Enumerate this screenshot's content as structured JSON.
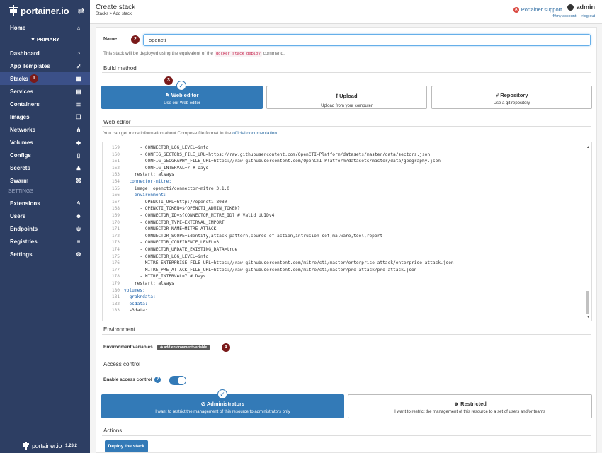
{
  "brand": {
    "name": "portainer.io",
    "toggle_icon": "exchange-icon"
  },
  "sidebar": {
    "items_top": [
      {
        "label": "Home",
        "icon": "home-icon",
        "glyph": "⌂"
      }
    ],
    "endpoint_label": "PRIMARY",
    "items_endpoint": [
      {
        "label": "Dashboard",
        "icon": "dashboard-icon",
        "glyph": "◔"
      },
      {
        "label": "App Templates",
        "icon": "rocket-icon",
        "glyph": "➶"
      },
      {
        "label": "Stacks",
        "icon": "th-list-icon",
        "glyph": "▦",
        "active": true
      },
      {
        "label": "Services",
        "icon": "list-alt-icon",
        "glyph": "▤"
      },
      {
        "label": "Containers",
        "icon": "server-icon",
        "glyph": "≣"
      },
      {
        "label": "Images",
        "icon": "clone-icon",
        "glyph": "❐"
      },
      {
        "label": "Networks",
        "icon": "sitemap-icon",
        "glyph": "⋔"
      },
      {
        "label": "Volumes",
        "icon": "cubes-icon",
        "glyph": "◆"
      },
      {
        "label": "Configs",
        "icon": "file-code-icon",
        "glyph": "▯"
      },
      {
        "label": "Secrets",
        "icon": "user-secret-icon",
        "glyph": "♟"
      },
      {
        "label": "Swarm",
        "icon": "object-group-icon",
        "glyph": "⌘"
      }
    ],
    "settings_title": "SETTINGS",
    "items_settings": [
      {
        "label": "Extensions",
        "icon": "bolt-icon",
        "glyph": "ϟ"
      },
      {
        "label": "Users",
        "icon": "users-icon",
        "glyph": "☻"
      },
      {
        "label": "Endpoints",
        "icon": "plug-icon",
        "glyph": "ψ"
      },
      {
        "label": "Registries",
        "icon": "database-icon",
        "glyph": "≡"
      },
      {
        "label": "Settings",
        "icon": "cogs-icon",
        "glyph": "⚙"
      }
    ],
    "footer_brand": "portainer.io",
    "version": "1.23.2"
  },
  "header": {
    "title": "Create stack",
    "breadcrumb": "Stacks > Add stack",
    "support": "Portainer support",
    "user": "admin",
    "my_account": "my account",
    "log_out": "log out"
  },
  "form": {
    "name_label": "Name",
    "name_value": "opencti",
    "deploy_note_pre": "This stack will be deployed using the equivalent of the",
    "deploy_note_code": "docker stack deploy",
    "deploy_note_post": "command.",
    "build_method_title": "Build method",
    "methods": [
      {
        "title": "Web editor",
        "subtitle": "Use our Web editor",
        "icon": "edit-icon",
        "selected": true
      },
      {
        "title": "Upload",
        "subtitle": "Upload from your computer",
        "icon": "upload-icon",
        "selected": false
      },
      {
        "title": "Repository",
        "subtitle": "Use a git repository",
        "icon": "git-icon",
        "selected": false
      }
    ],
    "web_editor_title": "Web editor",
    "web_editor_help_pre": "You can get more information about Compose file format in the",
    "web_editor_help_link": "official documentation",
    "web_editor_help_post": ".",
    "code_lines": [
      {
        "n": "159",
        "t": "      - CONNECTOR_LOG_LEVEL=info"
      },
      {
        "n": "160",
        "t": "      - CONFIG_SECTORS_FILE_URL=https://raw.githubusercontent.com/OpenCTI-Platform/datasets/master/data/sectors.json"
      },
      {
        "n": "161",
        "t": "      - CONFIG_GEOGRAPHY_FILE_URL=https://raw.githubusercontent.com/OpenCTI-Platform/datasets/master/data/geography.json"
      },
      {
        "n": "162",
        "t": "      - CONFIG_INTERVAL=7 # Days"
      },
      {
        "n": "163",
        "t": "    restart: always"
      },
      {
        "n": "164",
        "t": "  connector-mitre:"
      },
      {
        "n": "165",
        "t": "    image: opencti/connector-mitre:3.1.0"
      },
      {
        "n": "166",
        "t": "    environment:"
      },
      {
        "n": "167",
        "t": "      - OPENCTI_URL=http://opencti:8080"
      },
      {
        "n": "168",
        "t": "      - OPENCTI_TOKEN=${OPENCTI_ADMIN_TOKEN}"
      },
      {
        "n": "169",
        "t": "      - CONNECTOR_ID=${CONNECTOR_MITRE_ID} # Valid UUIDv4"
      },
      {
        "n": "170",
        "t": "      - CONNECTOR_TYPE=EXTERNAL_IMPORT"
      },
      {
        "n": "171",
        "t": "      - CONNECTOR_NAME=MITRE ATT&CK"
      },
      {
        "n": "172",
        "t": "      - CONNECTOR_SCOPE=identity,attack-pattern,course-of-action,intrusion-set,malware,tool,report"
      },
      {
        "n": "173",
        "t": "      - CONNECTOR_CONFIDENCE_LEVEL=3"
      },
      {
        "n": "174",
        "t": "      - CONNECTOR_UPDATE_EXISTING_DATA=true"
      },
      {
        "n": "175",
        "t": "      - CONNECTOR_LOG_LEVEL=info"
      },
      {
        "n": "176",
        "t": "      - MITRE_ENTERPRISE_FILE_URL=https://raw.githubusercontent.com/mitre/cti/master/enterprise-attack/enterprise-attack.json"
      },
      {
        "n": "177",
        "t": "      - MITRE_PRE_ATTACK_FILE_URL=https://raw.githubusercontent.com/mitre/cti/master/pre-attack/pre-attack.json"
      },
      {
        "n": "178",
        "t": "      - MITRE_INTERVAL=7 # Days"
      },
      {
        "n": "179",
        "t": "    restart: always"
      },
      {
        "n": "180",
        "t": "volumes:"
      },
      {
        "n": "181",
        "t": "  grakndata:"
      },
      {
        "n": "182",
        "t": "  esdata:"
      },
      {
        "n": "183",
        "t": "  s3data:"
      }
    ],
    "environment_title": "Environment",
    "env_vars_label": "Environment variables",
    "add_env_button": "add environment variable",
    "access_control_title": "Access control",
    "enable_access_label": "Enable access control",
    "access_options": [
      {
        "title": "Administrators",
        "subtitle": "I want to restrict the management of this resource to administrators only",
        "icon": "eye-slash-icon",
        "selected": true
      },
      {
        "title": "Restricted",
        "subtitle": "I want to restrict the management of this resource to a set of users and/or teams",
        "icon": "users-icon",
        "selected": false
      }
    ],
    "actions_title": "Actions",
    "deploy_button": "Deploy the stack"
  },
  "markers": [
    "1",
    "2",
    "3",
    "4"
  ],
  "colors": {
    "sidebar": "#2d3e63",
    "primary": "#337ab7",
    "marker": "#7a1a1a"
  }
}
